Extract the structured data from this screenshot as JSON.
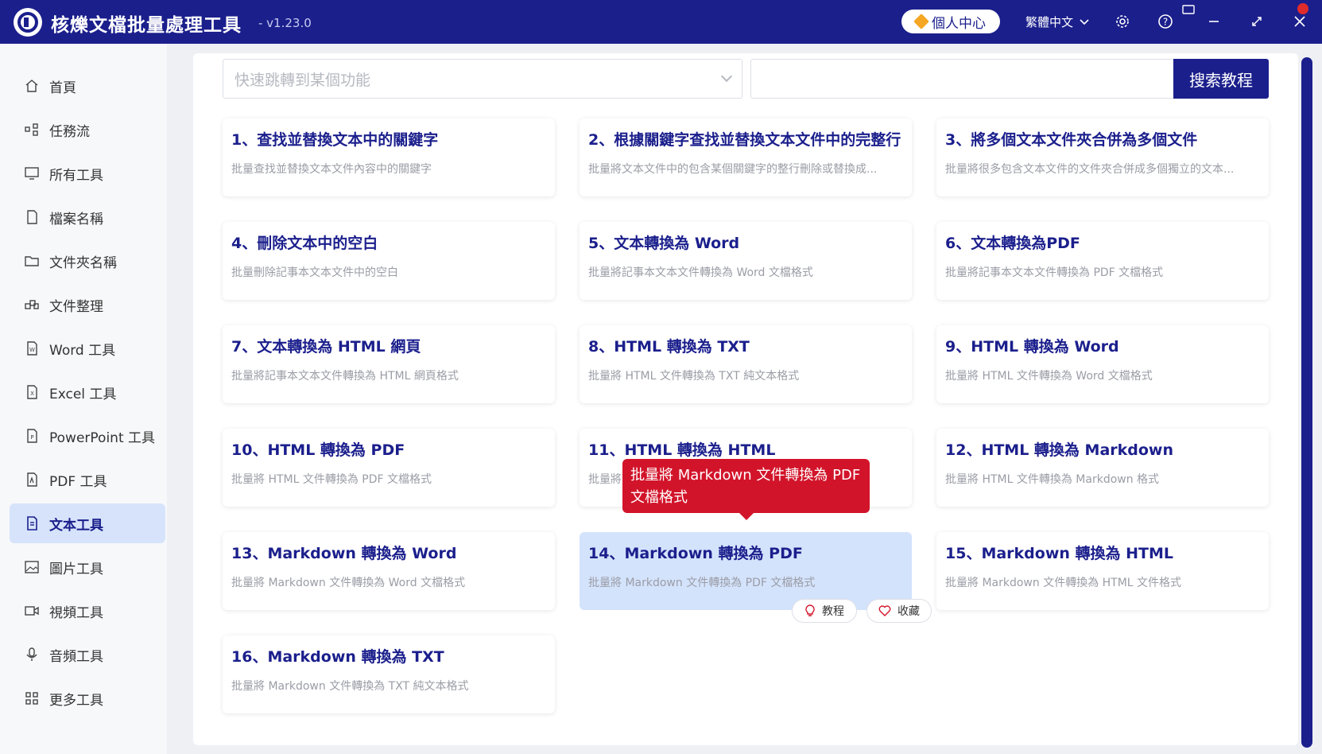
{
  "window": {
    "title": "核爍文檔批量處理工具",
    "version": "- v1.23.0",
    "personal_center": "個人中心",
    "language": "繁體中文"
  },
  "sidebar": {
    "items": [
      {
        "label": "首頁",
        "icon": "home-icon"
      },
      {
        "label": "任務流",
        "icon": "workflow-icon"
      },
      {
        "label": "所有工具",
        "icon": "monitor-icon"
      },
      {
        "label": "檔案名稱",
        "icon": "file-name-icon"
      },
      {
        "label": "文件夾名稱",
        "icon": "folder-icon"
      },
      {
        "label": "文件整理",
        "icon": "organize-icon"
      },
      {
        "label": "Word 工具",
        "icon": "word-icon"
      },
      {
        "label": "Excel 工具",
        "icon": "excel-icon"
      },
      {
        "label": "PowerPoint 工具",
        "icon": "powerpoint-icon"
      },
      {
        "label": "PDF 工具",
        "icon": "pdf-icon"
      },
      {
        "label": "文本工具",
        "icon": "text-icon"
      },
      {
        "label": "圖片工具",
        "icon": "image-icon"
      },
      {
        "label": "視頻工具",
        "icon": "video-icon"
      },
      {
        "label": "音頻工具",
        "icon": "audio-icon"
      },
      {
        "label": "更多工具",
        "icon": "grid-icon"
      }
    ],
    "active_index": 10
  },
  "search": {
    "select_placeholder": "快速跳轉到某個功能",
    "button_label": "搜索教程"
  },
  "cards": [
    {
      "title": "1、查找並替換文本中的關鍵字",
      "desc": "批量查找並替換文本文件內容中的關鍵字"
    },
    {
      "title": "2、根據關鍵字查找並替換文本文件中的完整行",
      "desc": "批量將文本文件中的包含某個關鍵字的整行刪除或替換成..."
    },
    {
      "title": "3、將多個文本文件夾合併為多個文件",
      "desc": "批量將很多包含文本文件的文件夾合併成多個獨立的文本..."
    },
    {
      "title": "4、刪除文本中的空白",
      "desc": "批量刪除記事本文本文件中的空白"
    },
    {
      "title": "5、文本轉換為 Word",
      "desc": "批量將記事本文本文件轉換為 Word 文檔格式"
    },
    {
      "title": "6、文本轉換為PDF",
      "desc": "批量將記事本文本文件轉換為 PDF 文檔格式"
    },
    {
      "title": "7、文本轉換為 HTML 網頁",
      "desc": "批量將記事本文本文件轉換為 HTML 網頁格式"
    },
    {
      "title": "8、HTML 轉換為 TXT",
      "desc": "批量將 HTML 文件轉換為 TXT 純文本格式"
    },
    {
      "title": "9、HTML 轉換為 Word",
      "desc": "批量將 HTML 文件轉換為 Word 文檔格式"
    },
    {
      "title": "10、HTML 轉換為 PDF",
      "desc": "批量將 HTML 文件轉換為 PDF 文檔格式"
    },
    {
      "title": "11、HTML 轉換為 HTML",
      "desc": "批量將"
    },
    {
      "title": "12、HTML 轉換為 Markdown",
      "desc": "批量將 HTML 文件轉換為 Markdown 格式"
    },
    {
      "title": "13、Markdown 轉換為 Word",
      "desc": "批量將 Markdown 文件轉換為 Word 文檔格式"
    },
    {
      "title": "14、Markdown 轉換為 PDF",
      "desc": "批量將 Markdown 文件轉換為 PDF 文檔格式"
    },
    {
      "title": "15、Markdown 轉換為 HTML",
      "desc": "批量將 Markdown 文件轉換為 HTML 文件格式"
    },
    {
      "title": "16、Markdown 轉換為 TXT",
      "desc": "批量將 Markdown 文件轉換為 TXT 純文本格式"
    }
  ],
  "hover_card": {
    "tutorial_label": "教程",
    "favorite_label": "收藏",
    "tooltip": "批量將 Markdown 文件轉換為 PDF 文檔格式"
  },
  "colors": {
    "brand": "#1b1f8c",
    "tooltip": "#d2142a",
    "active_bg": "#d6e3fb"
  }
}
